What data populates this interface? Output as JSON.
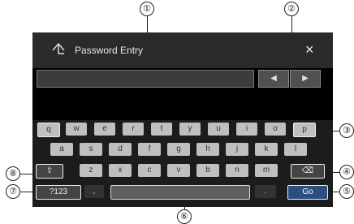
{
  "callouts": [
    "①",
    "②",
    "③",
    "④",
    "⑤",
    "⑥",
    "⑦",
    "⑧"
  ],
  "titlebar": {
    "back_icon": "arrow-up-icon",
    "title": "Password Entry",
    "close_label": "×"
  },
  "cursor_buttons": {
    "left": "◀",
    "right": "▶"
  },
  "keyboard": {
    "row1": [
      "q",
      "w",
      "e",
      "r",
      "t",
      "y",
      "u",
      "i",
      "o",
      "p"
    ],
    "row2": [
      "a",
      "s",
      "d",
      "f",
      "g",
      "h",
      "j",
      "k",
      "l"
    ],
    "row3": [
      "z",
      "x",
      "c",
      "v",
      "b",
      "n",
      "m"
    ],
    "shift_label": "⇧",
    "delete_label": "⌫",
    "numbers_label": "?123",
    "comma_label": ",",
    "period_label": ".",
    "go_label": "Go"
  }
}
